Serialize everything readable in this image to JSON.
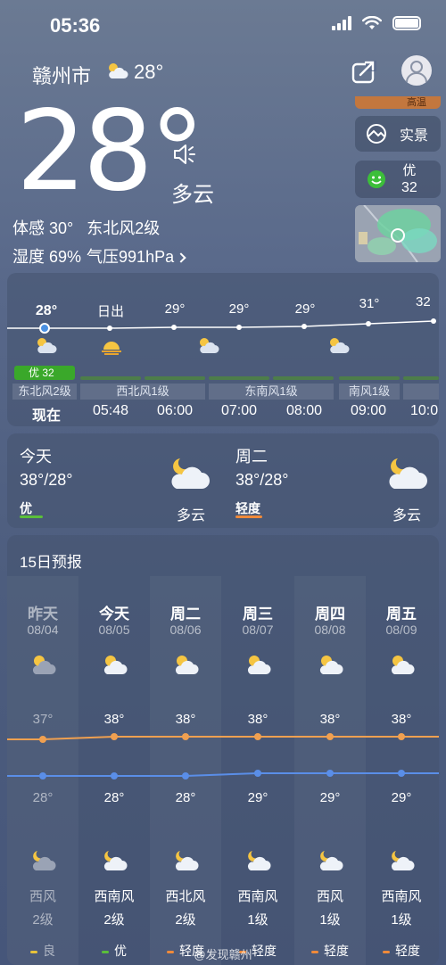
{
  "status": {
    "time": "05:36"
  },
  "header": {
    "city": "赣州市",
    "temp": "28°"
  },
  "current": {
    "temp": "28°",
    "condition": "多云",
    "feels": "体感 30°",
    "wind": "东北风2级",
    "humidity": "湿度 69%",
    "pressure": "气压991hPa",
    "alert_text": "高温",
    "realview_label": "实景",
    "aqi_label": "优",
    "aqi_value": "32"
  },
  "hourly": {
    "hours": [
      {
        "temp": "28°",
        "label": "现在",
        "icon": "cloud-sun-icon"
      },
      {
        "temp": "日出",
        "label": "05:48",
        "icon": "sunrise-icon"
      },
      {
        "temp": "29°",
        "label": "06:00",
        "icon": "none"
      },
      {
        "temp": "29°",
        "label": "07:00",
        "icon": "cloud-sun-icon"
      },
      {
        "temp": "29°",
        "label": "08:00",
        "icon": "none"
      },
      {
        "temp": "31°",
        "label": "09:00",
        "icon": "cloud-sun-icon"
      },
      {
        "temp": "32",
        "label": "10:0",
        "icon": "none"
      }
    ],
    "aqi_badge": "优 32",
    "winds": [
      "东北风2级",
      "西北风1级",
      "东南风1级",
      "南风1级"
    ]
  },
  "twoday": [
    {
      "day": "今天",
      "range": "38°/28°",
      "aq": "优",
      "aq_color": "#5bbf3a",
      "cond": "多云"
    },
    {
      "day": "周二",
      "range": "38°/28°",
      "aq": "轻度",
      "aq_color": "#f08a3a",
      "cond": "多云"
    }
  ],
  "forecast": {
    "title": "15日预报",
    "days": [
      {
        "name": "昨天",
        "date": "08/04",
        "high": "37°",
        "low": "28°",
        "wind": "西风",
        "level": "2级",
        "aq": "良",
        "aq_color": "#e8c23a"
      },
      {
        "name": "今天",
        "date": "08/05",
        "high": "38°",
        "low": "28°",
        "wind": "西南风",
        "level": "2级",
        "aq": "优",
        "aq_color": "#5bbf3a"
      },
      {
        "name": "周二",
        "date": "08/06",
        "high": "38°",
        "low": "28°",
        "wind": "西北风",
        "level": "2级",
        "aq": "轻度",
        "aq_color": "#f08a3a"
      },
      {
        "name": "周三",
        "date": "08/07",
        "high": "38°",
        "low": "29°",
        "wind": "西南风",
        "level": "1级",
        "aq": "轻度",
        "aq_color": "#f08a3a"
      },
      {
        "name": "周四",
        "date": "08/08",
        "high": "38°",
        "low": "29°",
        "wind": "西风",
        "level": "1级",
        "aq": "轻度",
        "aq_color": "#f08a3a"
      },
      {
        "name": "周五",
        "date": "08/09",
        "high": "38°",
        "low": "29°",
        "wind": "西南风",
        "level": "1级",
        "aq": "轻度",
        "aq_color": "#f08a3a"
      }
    ]
  },
  "watermark": "@发现赣州",
  "colors": {
    "high_line": "#f0a050",
    "low_line": "#5a8ee8",
    "aqi_green": "#3aa82a",
    "wind_bar": "#4d7d4a"
  }
}
